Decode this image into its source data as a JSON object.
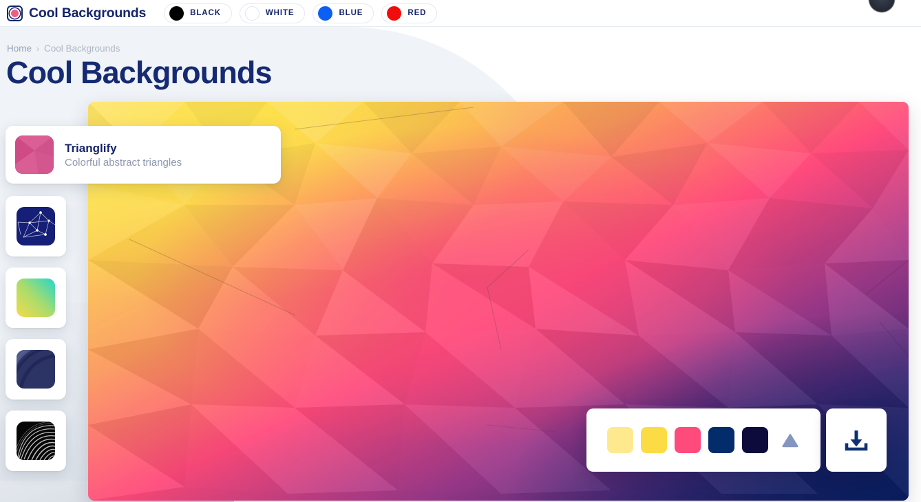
{
  "app": {
    "brand_title": "Cool Backgrounds",
    "logo_icon": "target-circle-icon"
  },
  "topbar": {
    "color_filters": [
      {
        "label": "BLACK",
        "color": "#000000",
        "icon": "color-dot-icon"
      },
      {
        "label": "WHITE",
        "color": "#ffffff",
        "icon": "color-dot-icon"
      },
      {
        "label": "BLUE",
        "color": "#0b5ff5",
        "icon": "color-dot-icon"
      },
      {
        "label": "RED",
        "color": "#f30c0c",
        "icon": "color-dot-icon"
      }
    ]
  },
  "breadcrumb": {
    "home_label": "Home",
    "separator": "›",
    "current_label": "Cool Backgrounds"
  },
  "page": {
    "title": "Cool Backgrounds"
  },
  "pattern_card": {
    "name": "Trianglify",
    "description": "Colorful abstract triangles",
    "thumb_icon": "trianglify-thumbnail"
  },
  "thumbnails": [
    {
      "name": "Particles",
      "icon": "particles-thumbnail"
    },
    {
      "name": "Gradient",
      "icon": "gradient-thumbnail"
    },
    {
      "name": "Arcs",
      "icon": "arcs-thumbnail"
    },
    {
      "name": "Moire",
      "icon": "moire-thumbnail"
    }
  ],
  "toolbar": {
    "swatches": [
      {
        "name": "swatch-light-yellow",
        "color": "#ffe98f"
      },
      {
        "name": "swatch-yellow",
        "color": "#fbdc44"
      },
      {
        "name": "swatch-pink",
        "color": "#ff4a7c"
      },
      {
        "name": "swatch-navy",
        "color": "#032c6a"
      },
      {
        "name": "swatch-dark-navy",
        "color": "#0d0a3c"
      }
    ],
    "triangle_icon": "triangle-up-icon",
    "triangle_color": "#8496bf",
    "download_icon": "download-icon",
    "download_color": "#0d3274"
  },
  "colors": {
    "brand_navy": "#16256b",
    "title_navy": "#162a72",
    "muted_text": "#9aa3b6",
    "page_bg": "#f0f4f8"
  },
  "canvas": {
    "pattern": "trianglify",
    "palette_start": "#ffe98f",
    "palette_mid": "#ff4a7c",
    "palette_end": "#0d0a3c"
  }
}
